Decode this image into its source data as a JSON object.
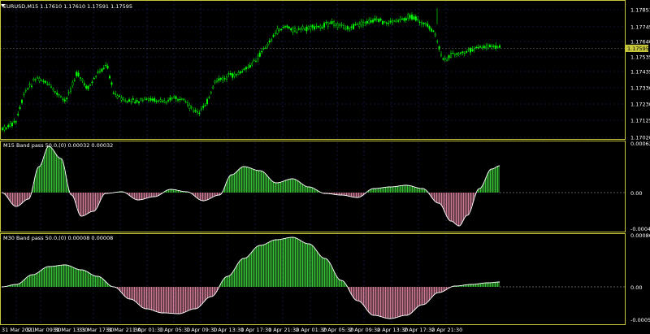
{
  "colors": {
    "background": "#000000",
    "frame": "#c6c63b",
    "grid": "#1a2a66",
    "candle": "#00ff00",
    "osc_pos": "#3ed63e",
    "osc_neg": "#e88aa8",
    "osc_line": "#ffffff",
    "price_tag_bg": "#c6c63b"
  },
  "main": {
    "symbol_header": "EURUSD,M15  1.17610 1.17610 1.17591 1.17595",
    "current_price": "1.17595",
    "y_labels": [
      "1.17851",
      "1.17745",
      "1.17640",
      "1.17535",
      "1.17435",
      "1.17330",
      "1.17230",
      "1.17125",
      "1.17020"
    ]
  },
  "panel1": {
    "header": "M15 Band pass 50.0,(0) 0.00032 0.00032",
    "y_top": "0.00062",
    "y_zero": "0.00",
    "y_bottom": "-0.00046"
  },
  "panel2": {
    "header": "M30 Band pass 50.0,(0) 0.00008 0.00008",
    "y_top": "0.00086",
    "y_zero": "0.00",
    "y_bottom": "-0.00059"
  },
  "x_labels": [
    "31 Mar 2021",
    "31 Mar 09:30",
    "31 Mar 13:30",
    "31 Mar 17:30",
    "31 Mar 21:30",
    "1 Apr 01:30",
    "1 Apr 05:30",
    "1 Apr 09:30",
    "1 Apr 13:30",
    "1 Apr 17:30",
    "1 Apr 21:30",
    "2 Apr 01:30",
    "2 Apr 05:30",
    "2 Apr 09:30",
    "2 Apr 13:30",
    "2 Apr 17:30",
    "2 Apr 21:30"
  ]
}
